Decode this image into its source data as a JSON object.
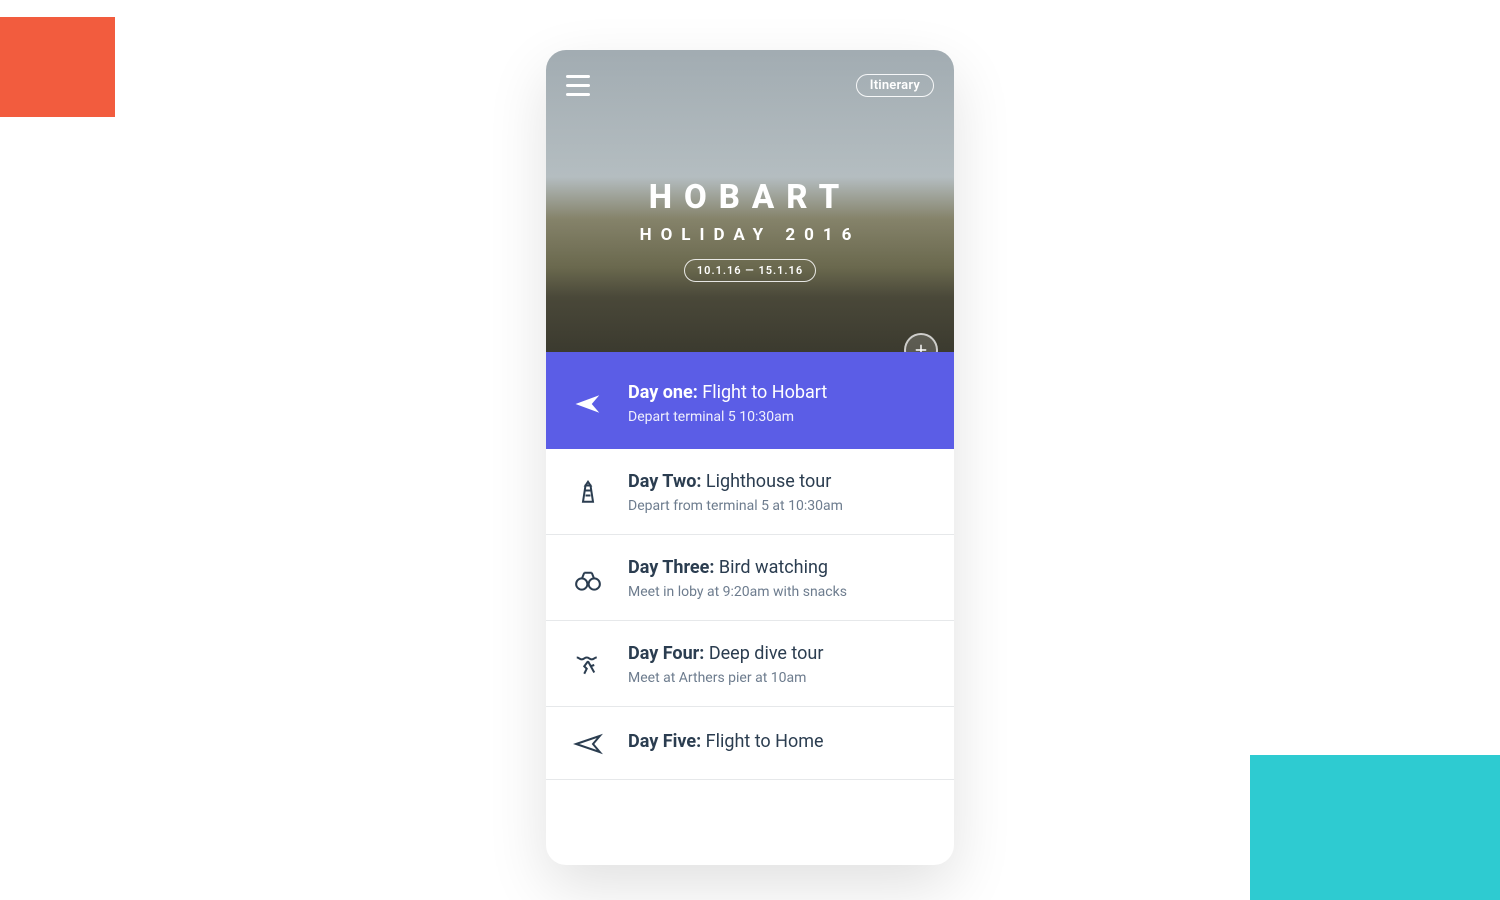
{
  "header": {
    "badge": "Itinerary",
    "title": "HOBART",
    "subtitle": "HOLIDAY 2016",
    "date_range": "10.1.16 — 15.1.16"
  },
  "days": [
    {
      "day": "Day one:",
      "activity": "Flight to Hobart",
      "detail": "Depart terminal 5 10:30am",
      "icon": "airplane",
      "active": true
    },
    {
      "day": "Day Two:",
      "activity": "Lighthouse tour",
      "detail": "Depart from terminal 5  at 10:30am",
      "icon": "lighthouse",
      "active": false
    },
    {
      "day": "Day Three:",
      "activity": "Bird watching",
      "detail": "Meet in loby at 9:20am with snacks",
      "icon": "binoculars",
      "active": false
    },
    {
      "day": "Day Four:",
      "activity": "Deep dive tour",
      "detail": "Meet at Arthers pier at 10am",
      "icon": "diving",
      "active": false
    },
    {
      "day": "Day Five:",
      "activity": "Flight to Home",
      "detail": "",
      "icon": "airplane-outline",
      "active": false
    }
  ],
  "colors": {
    "accent": "#5b5de6",
    "coral": "#f25c3e",
    "teal": "#2ecbd1"
  }
}
